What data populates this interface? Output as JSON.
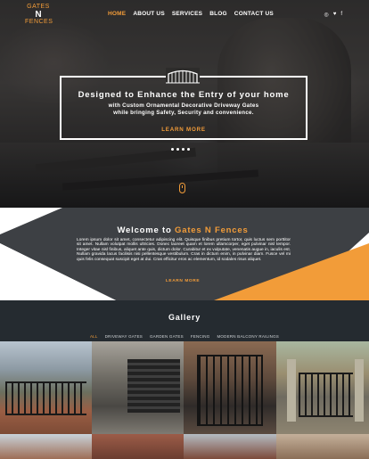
{
  "brand": {
    "line1": "GATES",
    "line2": "N",
    "line3": "FENCES"
  },
  "nav": {
    "items": [
      "HOME",
      "ABOUT US",
      "SERVICES",
      "BLOG",
      "CONTACT US"
    ],
    "active_index": 0
  },
  "social": [
    {
      "icon": "instagram-icon",
      "glyph": "◎"
    },
    {
      "icon": "twitter-icon",
      "glyph": "♥"
    },
    {
      "icon": "facebook-icon",
      "glyph": "f"
    }
  ],
  "hero": {
    "title": "Designed to Enhance the Entry of your home",
    "subtitle_line1": "with Custom Ornamental Decorative Driveway Gates",
    "subtitle_line2": "while bringing Safety, Security and convenience.",
    "cta": "LEARN MORE",
    "slide_count": 4
  },
  "welcome": {
    "title_prefix": "Welcome to ",
    "title_accent": "Gates N Fences",
    "body": "Lorem ipsum dolor sit amet, consectetur adipiscing elit. Quisque finibus pretium tortor, quis luctus sem porttitor sit amet. Nullam volutpat mollis ultricies. Donec laoreet quam et lorem ullamcorper, eget pulvinar nisl tempor. Integer vitae nisl finibus, aliquet ante quis, dictum dolor. Curabitur et ex vulputate, venenatis augue in, iaculis est. Nullam gravida lacus facilisis nisi pellentesque vestibulum. Cras in dictum enim, in pulvinar diam. Fusce vel mi quis felis consequat suscipit eget at dui. Cras efficitur eros ac elementum, id sodales risus aliquet.",
    "cta": "LEARN MORE"
  },
  "gallery": {
    "title": "Gallery",
    "filters": [
      "ALL",
      "DRIVEWAY GATES",
      "GARDEN GATES",
      "FENCING",
      "MODERN BALCONY RAILINGS"
    ],
    "active_filter": 0
  },
  "colors": {
    "accent": "#f29c39",
    "dark": "#3d4044",
    "footer": "#252b30"
  }
}
